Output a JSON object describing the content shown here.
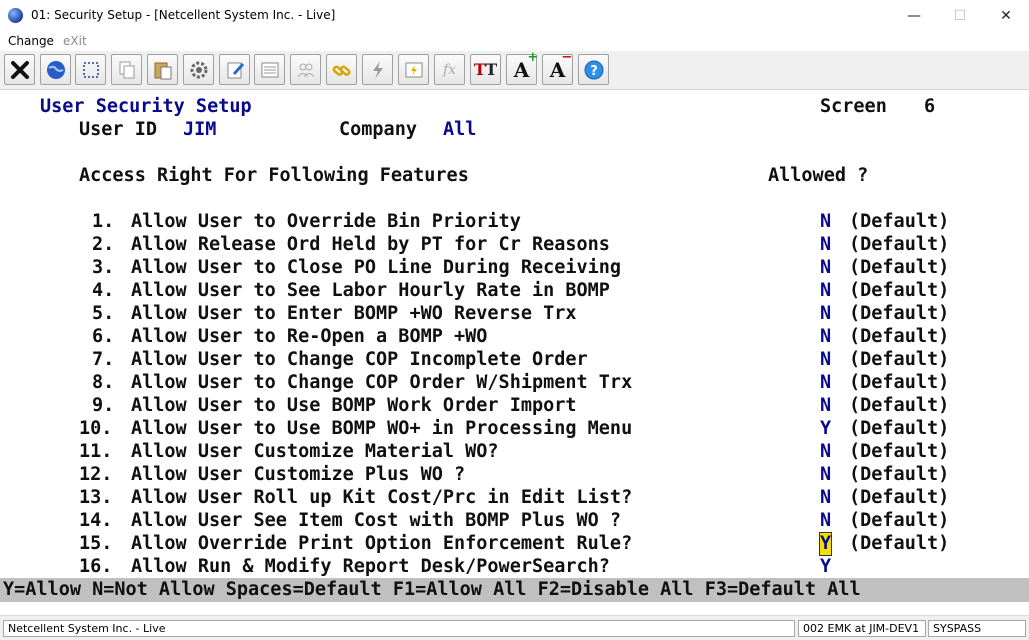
{
  "window": {
    "title": "01: Security Setup - [Netcellent System Inc. - Live]",
    "minimize": "—",
    "maximize": "☐",
    "close": "✕"
  },
  "menu": [
    "Change",
    "eXit"
  ],
  "toolbar": [
    "close-x-icon",
    "globe-icon",
    "select-rect-icon",
    "copy-icon",
    "paste-icon",
    "gear-icon",
    "edit-doc-icon",
    "list-icon",
    "users-icon",
    "link-icon",
    "lightning-icon",
    "document-lightning-icon",
    "function-icon",
    "font-type-icon",
    "font-increase-icon",
    "font-decrease-icon",
    "help-icon"
  ],
  "screen": {
    "heading": "User Security Setup",
    "screen_label": "Screen",
    "screen_number": "6",
    "user_id_label": "User ID",
    "user_id": "JIM",
    "company_label": "Company",
    "company": "All",
    "access_header": "Access Right For Following Features",
    "allowed_header": "Allowed ?"
  },
  "rows": [
    {
      "num": "1.",
      "label": "Allow User to Override Bin Priority",
      "value": "N",
      "default": "(Default)"
    },
    {
      "num": "2.",
      "label": "Allow Release Ord Held by PT for Cr Reasons",
      "value": "N",
      "default": "(Default)"
    },
    {
      "num": "3.",
      "label": "Allow User to Close PO Line During Receiving",
      "value": "N",
      "default": "(Default)"
    },
    {
      "num": "4.",
      "label": "Allow User to See Labor Hourly Rate in BOMP",
      "value": "N",
      "default": "(Default)"
    },
    {
      "num": "5.",
      "label": "Allow User to Enter BOMP +WO Reverse Trx",
      "value": "N",
      "default": "(Default)"
    },
    {
      "num": "6.",
      "label": "Allow User to Re-Open a BOMP +WO",
      "value": "N",
      "default": "(Default)"
    },
    {
      "num": "7.",
      "label": "Allow User to Change COP Incomplete Order",
      "value": "N",
      "default": "(Default)"
    },
    {
      "num": "8.",
      "label": "Allow User to Change COP Order W/Shipment Trx",
      "value": "N",
      "default": "(Default)"
    },
    {
      "num": "9.",
      "label": "Allow User to Use BOMP Work Order Import",
      "value": "N",
      "default": "(Default)"
    },
    {
      "num": "10.",
      "label": "Allow User to Use BOMP WO+ in Processing Menu",
      "value": "Y",
      "default": "(Default)"
    },
    {
      "num": "11.",
      "label": "Allow User Customize Material WO?",
      "value": "N",
      "default": "(Default)"
    },
    {
      "num": "12.",
      "label": "Allow User Customize Plus WO ?",
      "value": "N",
      "default": "(Default)"
    },
    {
      "num": "13.",
      "label": "Allow User Roll up Kit Cost/Prc in Edit List?",
      "value": "N",
      "default": "(Default)"
    },
    {
      "num": "14.",
      "label": "Allow User See Item Cost with BOMP Plus WO ?",
      "value": "N",
      "default": "(Default)"
    },
    {
      "num": "15.",
      "label": "Allow Override Print Option Enforcement Rule?",
      "value": "Y",
      "default": "(Default)"
    },
    {
      "num": "16.",
      "label": "Allow Run & Modify Report Desk/PowerSearch?",
      "value": "Y",
      "default": ""
    }
  ],
  "help_line": "Y=Allow N=Not Allow Spaces=Default F1=Allow All F2=Disable All F3=Default All",
  "statusbar": {
    "company": "Netcellent System Inc. - Live",
    "session": "002 EMK at JIM-DEV1",
    "user": "SYSPASS"
  }
}
